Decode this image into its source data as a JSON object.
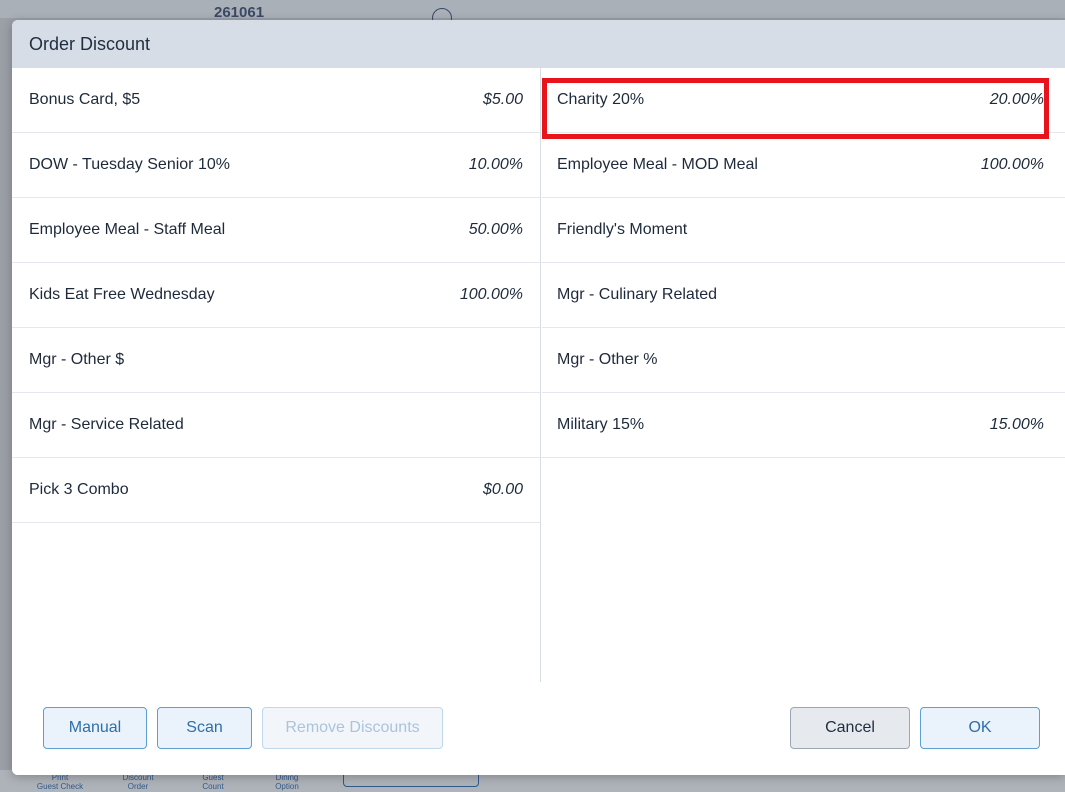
{
  "background": {
    "order_number": "261061",
    "bottom_labels": [
      "Print\nGuest Check",
      "Discount\nOrder",
      "Guest\nCount",
      "Dining\nOption"
    ]
  },
  "modal": {
    "title": "Order Discount",
    "left_items": [
      {
        "name": "Bonus Card, $5",
        "value": "$5.00"
      },
      {
        "name": "DOW - Tuesday Senior 10%",
        "value": "10.00%"
      },
      {
        "name": "Employee Meal - Staff Meal",
        "value": "50.00%"
      },
      {
        "name": "Kids Eat Free Wednesday",
        "value": "100.00%"
      },
      {
        "name": "Mgr - Other $",
        "value": ""
      },
      {
        "name": "Mgr - Service Related",
        "value": ""
      },
      {
        "name": "Pick 3 Combo",
        "value": "$0.00"
      }
    ],
    "right_items": [
      {
        "name": "Charity 20%",
        "value": "20.00%"
      },
      {
        "name": "Employee Meal - MOD Meal",
        "value": "100.00%"
      },
      {
        "name": "Friendly's Moment",
        "value": ""
      },
      {
        "name": "Mgr - Culinary Related",
        "value": ""
      },
      {
        "name": "Mgr - Other %",
        "value": ""
      },
      {
        "name": "Military 15%",
        "value": "15.00%"
      }
    ],
    "buttons": {
      "manual": "Manual",
      "scan": "Scan",
      "remove": "Remove Discounts",
      "cancel": "Cancel",
      "ok": "OK"
    }
  },
  "colors": {
    "highlight": "#e8141c",
    "accent": "#2e6fa8"
  }
}
